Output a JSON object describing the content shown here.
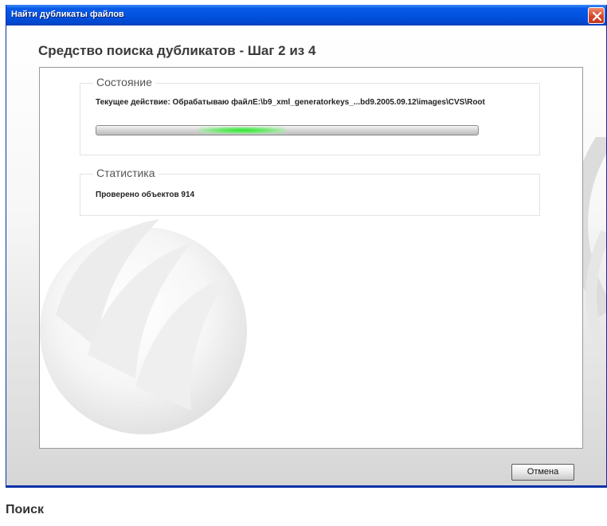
{
  "window": {
    "title": "Найти дубликаты файлов",
    "close_icon": "close-icon",
    "heading": "Средство поиска дубликатов - Шаг 2 из 4"
  },
  "status": {
    "title": "Состояние",
    "action_line": "Текущее действие:  Обрабатываю файлE:\\b9_xml_generatorkeys_...bd9.2005.09.12\\images\\CVS\\Root",
    "progress_mode": "indeterminate"
  },
  "stats": {
    "title": "Статистика",
    "line": "Проверено объектов 914"
  },
  "buttons": {
    "cancel": "Отмена"
  },
  "caption": "Поиск",
  "colors": {
    "titlebar": "#0254e0",
    "close": "#d6462a",
    "progress_glow": "#33e433"
  }
}
